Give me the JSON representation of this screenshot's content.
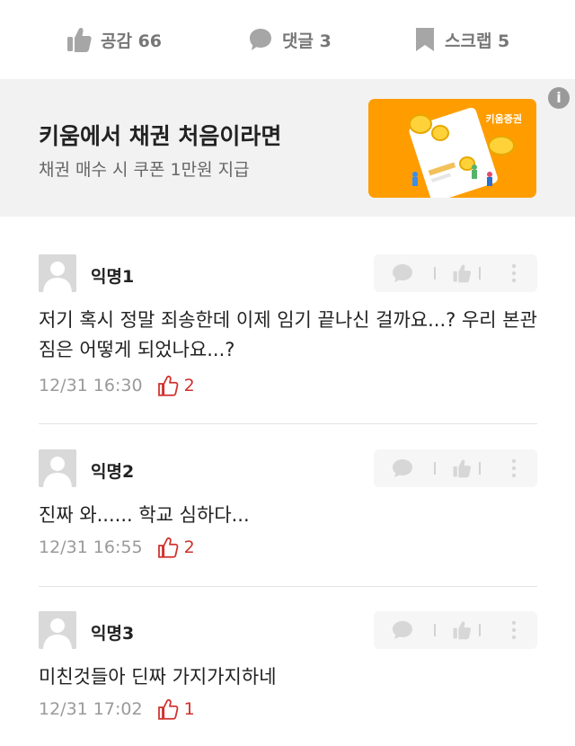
{
  "actions": {
    "like_label": "공감 66",
    "comment_label": "댓글 3",
    "scrap_label": "스크랩 5"
  },
  "ad": {
    "title": "키움에서 채권 처음이라면",
    "subtitle": "채권 매수 시 쿠폰 1만원 지급",
    "info_icon": "i",
    "brand": "키움증권"
  },
  "comments": [
    {
      "author": "익명1",
      "text": "저기 혹시 정말 죄송한데 이제 임기 끝나신 걸까요...? 우리 본관 짐은 어떻게 되었나요...?",
      "time": "12/31 16:30",
      "likes": "2"
    },
    {
      "author": "익명2",
      "text": "진짜 와...... 학교 심하다...",
      "time": "12/31 16:55",
      "likes": "2"
    },
    {
      "author": "익명3",
      "text": "미친것들아 딘짜 가지가지하네",
      "time": "12/31 17:02",
      "likes": "1"
    }
  ],
  "colors": {
    "accent_red": "#d0312d",
    "banner_bg": "#f2f2f2",
    "thumb_orange": "#ff9d00"
  },
  "icons": {
    "like": "thumbs-up-icon",
    "comment": "speech-bubble-icon",
    "scrap": "bookmark-icon",
    "more": "more-vertical-icon",
    "likes_count": "thumbs-up-outline-icon"
  }
}
